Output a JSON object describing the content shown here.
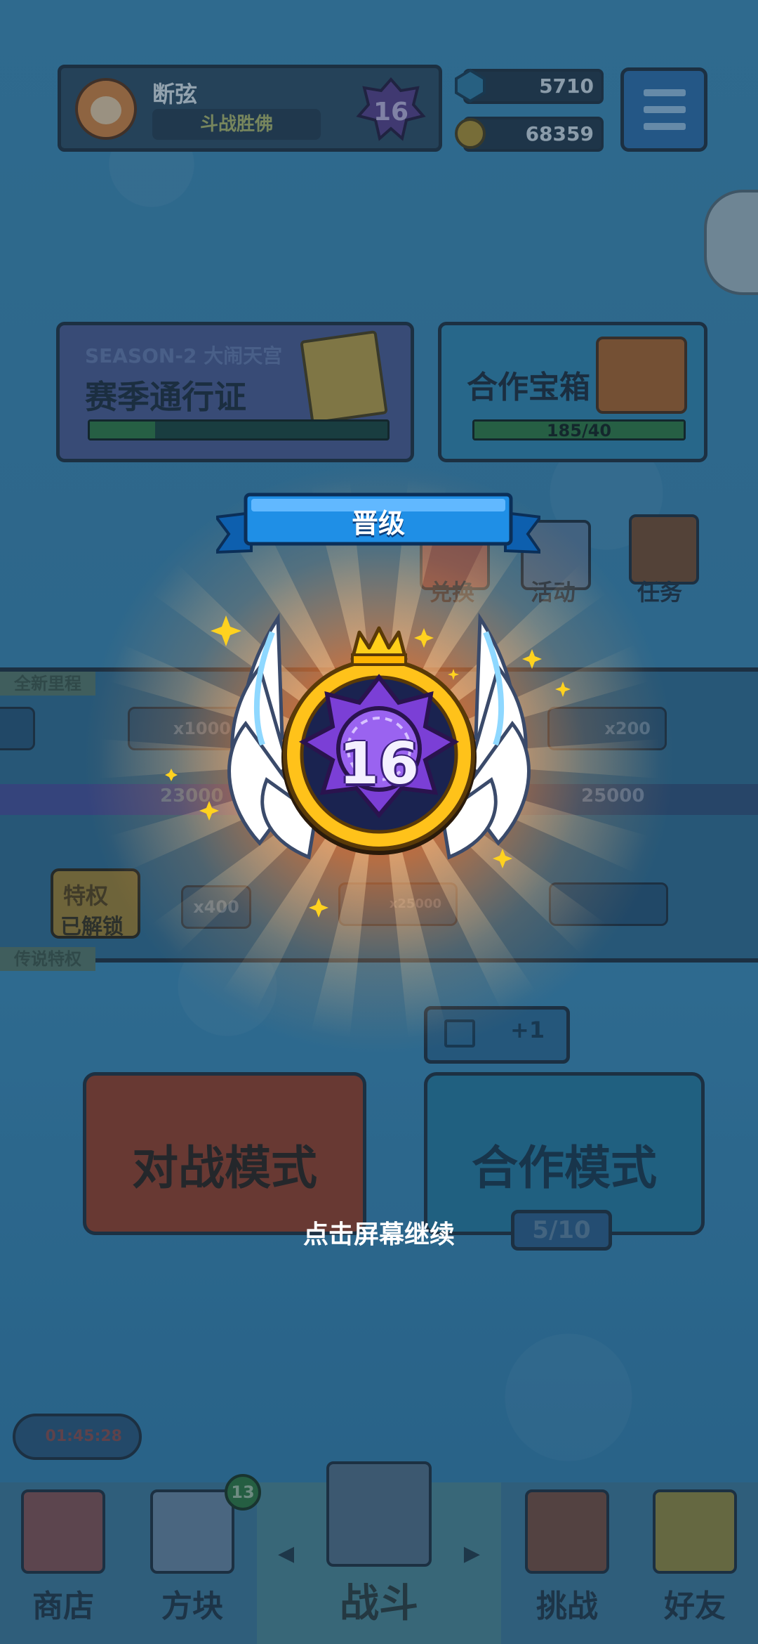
{
  "profile": {
    "name": "断弦",
    "title": "斗战胜佛",
    "rank_level": "16"
  },
  "currencies": {
    "gems": "5710",
    "coins": "68359"
  },
  "season_card": {
    "subtitle": "SEASON-2 大闹天宫",
    "title": "赛季通行证",
    "progress": 0.22
  },
  "coop_card": {
    "title": "合作宝箱",
    "progress_text": "185/40",
    "progress": 1.0
  },
  "mini_icons": {
    "exchange": "兑换",
    "activity": "活动",
    "task": "任务"
  },
  "road": {
    "top_tag": "全新里程",
    "bottom_tag": "传说特权",
    "pill_left": "x1000",
    "pill_right": "x200",
    "num_left": "23000",
    "num_right": "25000",
    "reward_x": "x400",
    "reward_mid": "x25000",
    "unlock_top": "特权",
    "unlock_bottom": "已解锁"
  },
  "modes": {
    "battle": "对战模式",
    "coop": "合作模式",
    "coop_count": "5/10",
    "video_plus": "+1"
  },
  "timer": "01:45:28",
  "nav": {
    "shop": "商店",
    "blocks": "方块",
    "battle": "战斗",
    "challenge": "挑战",
    "friends": "好友",
    "blocks_badge": "13"
  },
  "modal": {
    "ribbon": "晋级",
    "rank_number": "16",
    "continue": "点击屏幕继续"
  },
  "colors": {
    "ribbon_blue": "#1f8fe6",
    "emblem_purple": "#7b3fd6",
    "ring_gold": "#ffc21a",
    "ray_orange": "#ff6a1f"
  }
}
